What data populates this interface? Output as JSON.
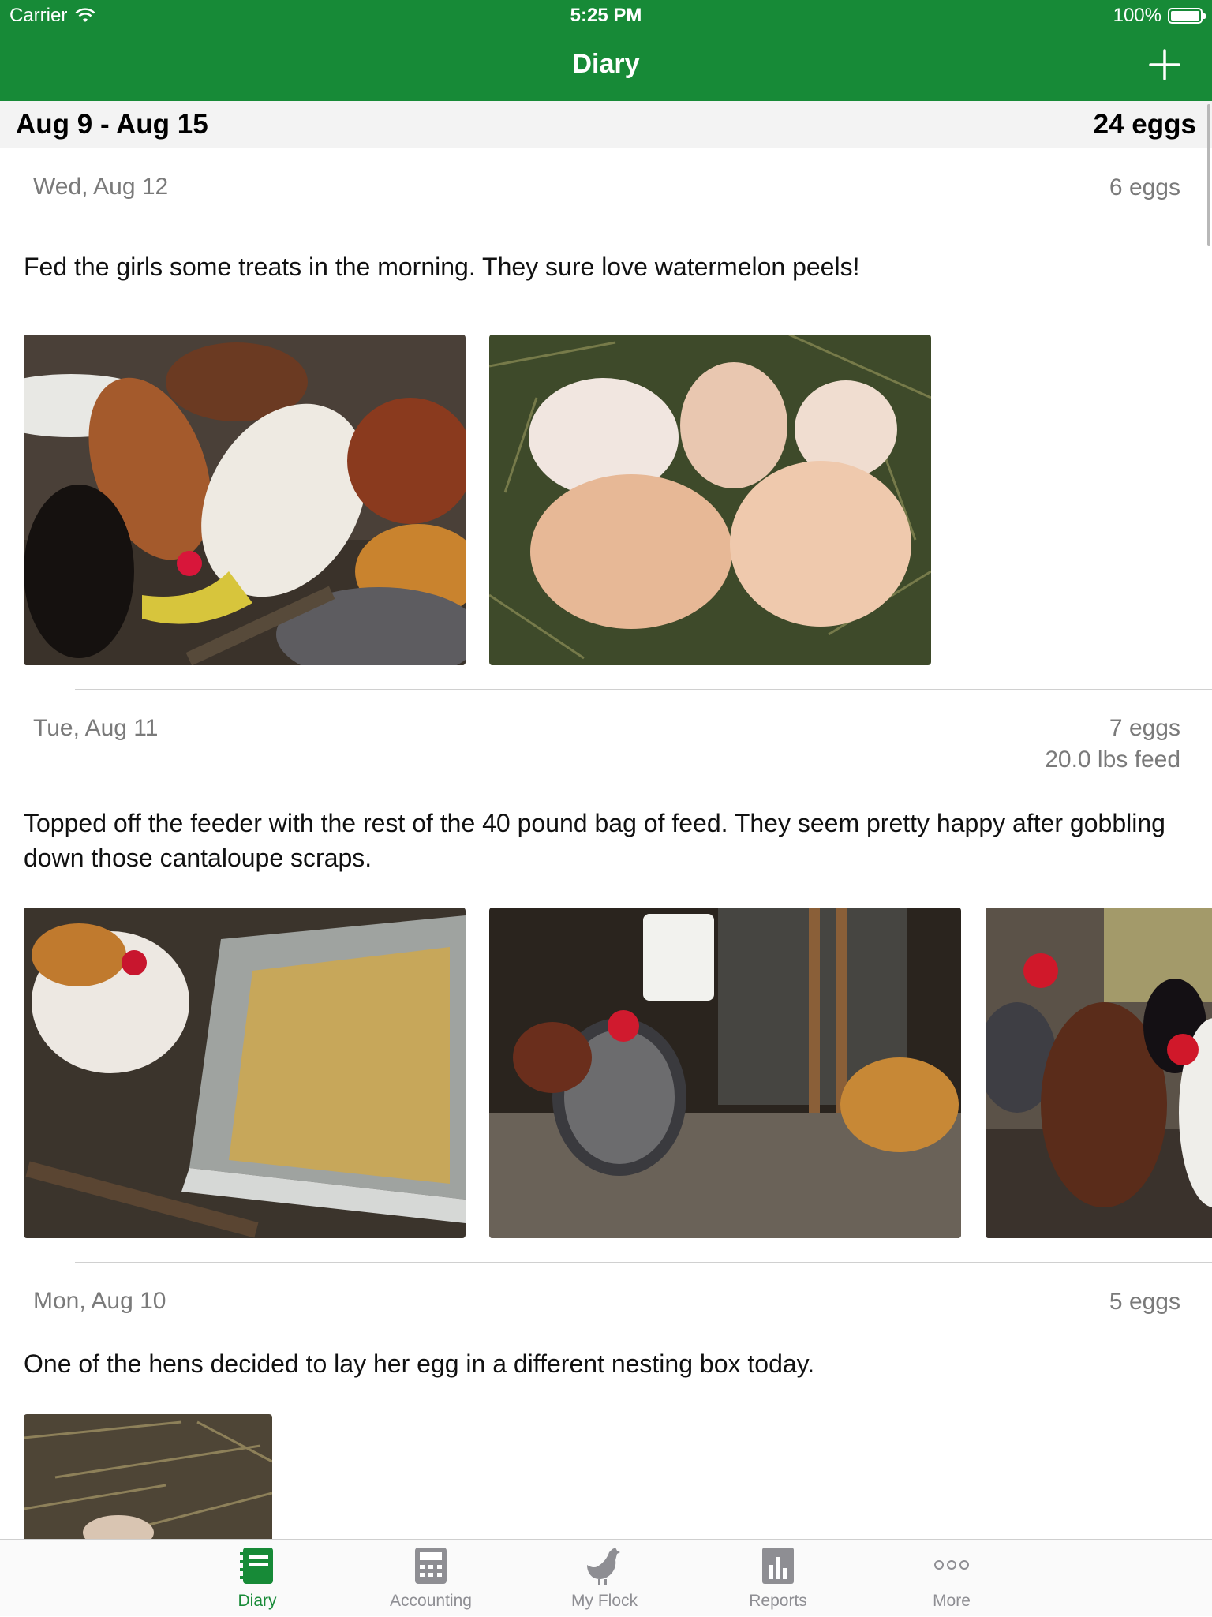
{
  "status_bar": {
    "carrier": "Carrier",
    "time": "5:25 PM",
    "battery": "100%"
  },
  "nav": {
    "title": "Diary",
    "add_icon": "plus-icon"
  },
  "week": {
    "range": "Aug 9 - Aug 15",
    "total": "24 eggs"
  },
  "entries": [
    {
      "date": "Wed, Aug 12",
      "eggs": "6 eggs",
      "note": "Fed the girls some treats in the morning. They sure love watermelon peels!",
      "photos": [
        "chickens-eating-watermelon",
        "eggs-in-nest"
      ]
    },
    {
      "date": "Tue, Aug 11",
      "eggs": "7 eggs",
      "feed": "20.0 lbs feed",
      "note": "Topped off the feeder with the rest of the 40 pound bag of feed. They seem pretty happy after gobbling down those cantaloupe scraps.",
      "photos": [
        "feeder-tray",
        "coop-chickens",
        "hens-closeup"
      ]
    },
    {
      "date": "Mon, Aug 10",
      "eggs": "5 eggs",
      "note": "One of the hens decided to lay her egg in a different nesting box today.",
      "photos": [
        "nesting-box"
      ]
    }
  ],
  "tabs": [
    {
      "label": "Diary",
      "icon": "diary-icon",
      "active": true
    },
    {
      "label": "Accounting",
      "icon": "calculator-icon",
      "active": false
    },
    {
      "label": "My Flock",
      "icon": "chicken-icon",
      "active": false
    },
    {
      "label": "Reports",
      "icon": "bar-chart-icon",
      "active": false
    },
    {
      "label": "More",
      "icon": "more-dots-icon",
      "active": false
    }
  ],
  "colors": {
    "brand_green": "#178a37",
    "secondary_text": "#7a7a7a",
    "inactive_tab": "#8e8e93"
  }
}
